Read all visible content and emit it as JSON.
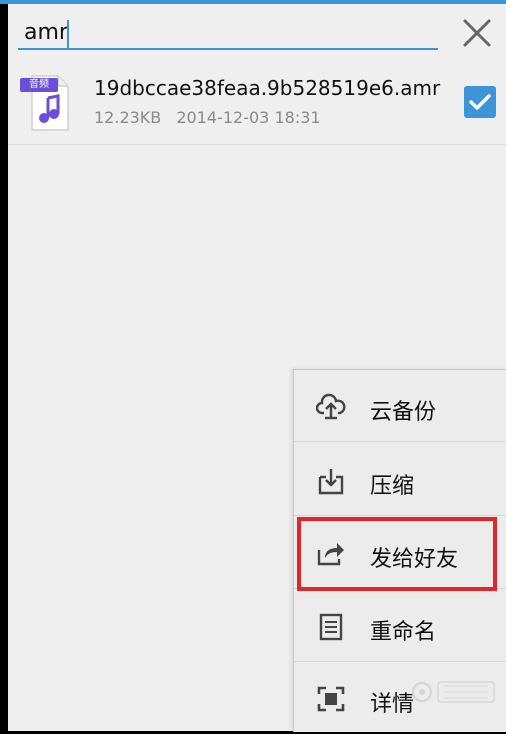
{
  "search": {
    "value": "amr"
  },
  "file": {
    "badge": "音频",
    "name": "19dbccae38feaa.9b528519e6.amr",
    "size": "12.23KB",
    "datetime": "2014-12-03 18:31",
    "selected": true
  },
  "menu": {
    "items": [
      {
        "label": "云备份",
        "icon": "cloud-upload-icon"
      },
      {
        "label": "压缩",
        "icon": "compress-icon"
      },
      {
        "label": "发给好友",
        "icon": "share-icon"
      },
      {
        "label": "重命名",
        "icon": "rename-icon"
      },
      {
        "label": "详情",
        "icon": "details-icon"
      }
    ]
  },
  "colors": {
    "accent": "#3b95d6",
    "highlight": "#e0262b",
    "badge": "#6a4fd8"
  }
}
